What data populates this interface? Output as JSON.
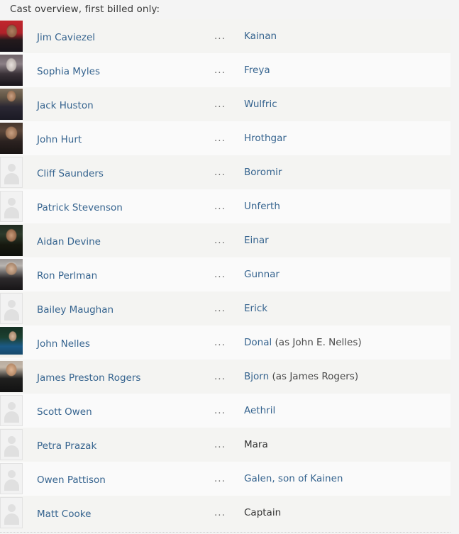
{
  "panel": {
    "heading": "Cast overview, first billed only:",
    "separator": "...",
    "link_color": "#36648f",
    "row_odd_color": "#f4f4f2",
    "row_even_color": "#fafafa",
    "page_background": "#f4f4f4"
  },
  "cast": [
    {
      "actor": "Jim Caviezel",
      "separator": "...",
      "character": "Kainan",
      "character_is_link": true,
      "credit_note": "",
      "thumbnail": "photo-jim-caviezel"
    },
    {
      "actor": "Sophia Myles",
      "separator": "...",
      "character": "Freya",
      "character_is_link": true,
      "credit_note": "",
      "thumbnail": "photo-sophia-myles"
    },
    {
      "actor": "Jack Huston",
      "separator": "...",
      "character": "Wulfric",
      "character_is_link": true,
      "credit_note": "",
      "thumbnail": "photo-jack-huston"
    },
    {
      "actor": "John Hurt",
      "separator": "...",
      "character": "Hrothgar",
      "character_is_link": true,
      "credit_note": "",
      "thumbnail": "photo-john-hurt"
    },
    {
      "actor": "Cliff Saunders",
      "separator": "...",
      "character": "Boromir",
      "character_is_link": true,
      "credit_note": "",
      "thumbnail": "placeholder-avatar"
    },
    {
      "actor": "Patrick Stevenson",
      "separator": "...",
      "character": "Unferth",
      "character_is_link": true,
      "credit_note": "",
      "thumbnail": "placeholder-avatar"
    },
    {
      "actor": "Aidan Devine",
      "separator": "...",
      "character": "Einar",
      "character_is_link": true,
      "credit_note": "",
      "thumbnail": "photo-aidan-devine"
    },
    {
      "actor": "Ron Perlman",
      "separator": "...",
      "character": "Gunnar",
      "character_is_link": true,
      "credit_note": "",
      "thumbnail": "photo-ron-perlman"
    },
    {
      "actor": "Bailey Maughan",
      "separator": "...",
      "character": "Erick",
      "character_is_link": true,
      "credit_note": "",
      "thumbnail": "placeholder-avatar"
    },
    {
      "actor": "John Nelles",
      "separator": "...",
      "character": "Donal",
      "character_is_link": true,
      "credit_note": "(as John E. Nelles)",
      "thumbnail": "photo-john-nelles"
    },
    {
      "actor": "James Preston Rogers",
      "separator": "...",
      "character": "Bjorn",
      "character_is_link": true,
      "credit_note": "(as James Rogers)",
      "thumbnail": "photo-james-preston-rogers"
    },
    {
      "actor": "Scott Owen",
      "separator": "...",
      "character": "Aethril",
      "character_is_link": true,
      "credit_note": "",
      "thumbnail": "placeholder-avatar"
    },
    {
      "actor": "Petra Prazak",
      "separator": "...",
      "character": "Mara",
      "character_is_link": false,
      "credit_note": "",
      "thumbnail": "placeholder-avatar"
    },
    {
      "actor": "Owen Pattison",
      "separator": "...",
      "character": "Galen, son of Kainen",
      "character_is_link": true,
      "credit_note": "",
      "thumbnail": "placeholder-avatar"
    },
    {
      "actor": "Matt Cooke",
      "separator": "...",
      "character": "Captain",
      "character_is_link": false,
      "credit_note": "",
      "thumbnail": "placeholder-avatar"
    }
  ]
}
